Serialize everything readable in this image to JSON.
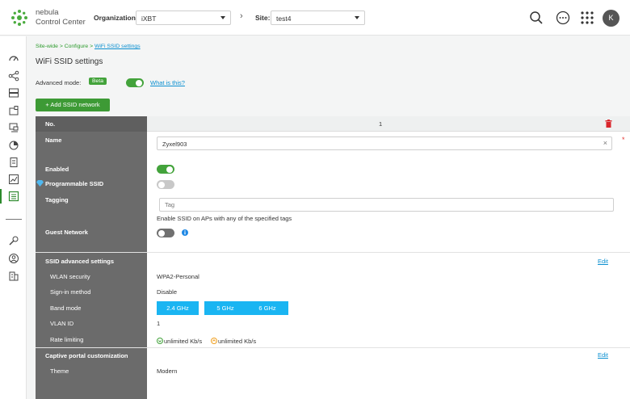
{
  "brand": {
    "line1": "nebula",
    "line2": "Control Center"
  },
  "header": {
    "org_label": "Organization:",
    "org_value": "iXBT",
    "site_label": "Site:",
    "site_value": "test4",
    "avatar_letter": "K"
  },
  "breadcrumb": {
    "part1": "Site-wide",
    "part2": "Configure",
    "current": "WiFi SSID settings"
  },
  "page_title": "WiFi SSID settings",
  "advanced_mode": {
    "label": "Advanced mode:",
    "badge": "Beta",
    "help_link": "What is this?",
    "enabled": true
  },
  "add_button": "+ Add SSID network",
  "table": {
    "no_label": "No.",
    "no_value": "1",
    "name_label": "Name",
    "name_value": "Zyxel903",
    "required_mark": "*",
    "clear_glyph": "×",
    "enabled_label": "Enabled",
    "programmable_label": "Programmable SSID",
    "tagging_label": "Tagging",
    "tag_placeholder": "Tag",
    "tag_hint": "Enable SSID on APs with any of the specified tags",
    "guest_label": "Guest Network",
    "adv_label": "SSID advanced settings",
    "edit_label": "Edit",
    "wlan_security_label": "WLAN security",
    "wlan_security_value": "WPA2-Personal",
    "signin_label": "Sign-in method",
    "signin_value": "Disable",
    "band_label": "Band mode",
    "bands": [
      "2.4 GHz",
      "5 GHz",
      "6 GHz"
    ],
    "vlan_label": "VLAN ID",
    "vlan_value": "1",
    "rate_label": "Rate limiting",
    "rate_down": "unlimited Kb/s",
    "rate_up": "unlimited Kb/s",
    "captive_label": "Captive portal customization",
    "theme_label": "Theme",
    "theme_value": "Modern"
  },
  "toggles": {
    "enabled": true,
    "programmable": false,
    "guest": false
  },
  "colors": {
    "accent_green": "#43a33b",
    "link_blue": "#0a8fd0",
    "band_blue": "#1ab5f2",
    "delete_red": "#d9262c"
  }
}
